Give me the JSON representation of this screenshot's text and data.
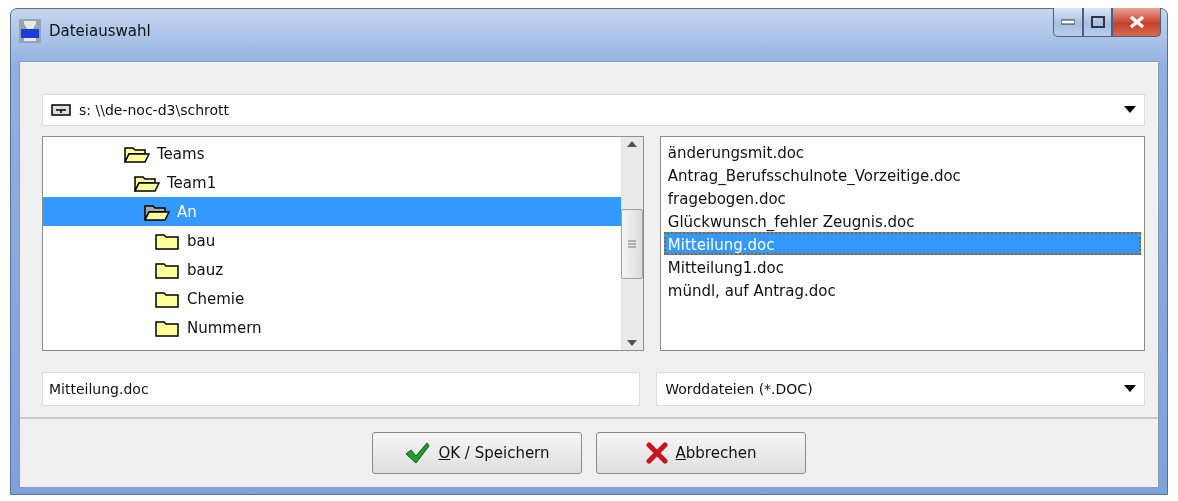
{
  "window": {
    "title": "Dateiauswahl"
  },
  "drive": {
    "value": "s: \\\\de-noc-d3\\schrott"
  },
  "folders": [
    {
      "name": "Teams",
      "expanded": true,
      "selected": false,
      "children": [
        {
          "name": "Team1",
          "expanded": true,
          "selected": false,
          "children": [
            {
              "name": "An",
              "expanded": true,
              "selected": true,
              "children": [
                {
                  "name": "bau",
                  "expanded": false,
                  "selected": false
                },
                {
                  "name": "bauz",
                  "expanded": false,
                  "selected": false
                },
                {
                  "name": "Chemie",
                  "expanded": false,
                  "selected": false
                },
                {
                  "name": "Nummern",
                  "expanded": false,
                  "selected": false
                }
              ]
            }
          ]
        }
      ]
    }
  ],
  "files": [
    {
      "name": "änderungsmit.doc",
      "selected": false
    },
    {
      "name": "Antrag_Berufsschulnote_Vorzeitige.doc",
      "selected": false
    },
    {
      "name": "fragebogen.doc",
      "selected": false
    },
    {
      "name": "Glückwunsch_fehler Zeugnis.doc",
      "selected": false
    },
    {
      "name": "Mitteilung.doc",
      "selected": true
    },
    {
      "name": "Mitteilung1.doc",
      "selected": false
    },
    {
      "name": "mündl, auf Antrag.doc",
      "selected": false
    }
  ],
  "filename": {
    "value": "Mitteilung.doc"
  },
  "filetype": {
    "value": "Worddateien (*.DOC)"
  },
  "buttons": [
    {
      "kind": "ok",
      "mnemonic": "O",
      "rest": "K / Speichern"
    },
    {
      "kind": "cancel",
      "mnemonic": "A",
      "rest": "bbrechen"
    }
  ]
}
